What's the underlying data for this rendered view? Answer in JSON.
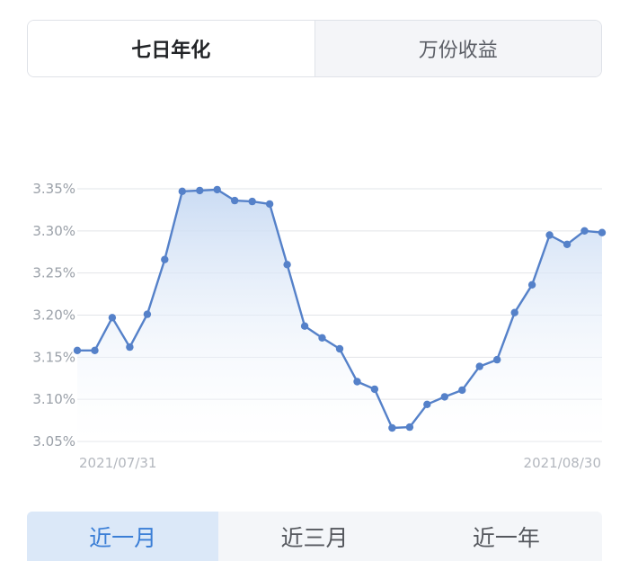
{
  "tabs": [
    {
      "label": "七日年化",
      "active": true
    },
    {
      "label": "万份收益",
      "active": false
    }
  ],
  "range_tabs": [
    {
      "label": "近一月",
      "active": true
    },
    {
      "label": "近三月",
      "active": false
    },
    {
      "label": "近一年",
      "active": false
    }
  ],
  "colors": {
    "line": "#5581c9",
    "fill_top": "#c8daf3",
    "grid": "#e2e4e8",
    "active_tab_text": "#3a7ed6"
  },
  "chart_data": {
    "type": "area",
    "x": [
      "2021/07/31",
      "2021/08/01",
      "2021/08/02",
      "2021/08/03",
      "2021/08/04",
      "2021/08/05",
      "2021/08/06",
      "2021/08/07",
      "2021/08/08",
      "2021/08/09",
      "2021/08/10",
      "2021/08/11",
      "2021/08/12",
      "2021/08/13",
      "2021/08/14",
      "2021/08/15",
      "2021/08/16",
      "2021/08/17",
      "2021/08/18",
      "2021/08/19",
      "2021/08/20",
      "2021/08/21",
      "2021/08/22",
      "2021/08/23",
      "2021/08/24",
      "2021/08/25",
      "2021/08/26",
      "2021/08/27",
      "2021/08/28",
      "2021/08/29",
      "2021/08/30"
    ],
    "values": [
      3.158,
      3.158,
      3.197,
      3.162,
      3.201,
      3.266,
      3.347,
      3.348,
      3.349,
      3.336,
      3.335,
      3.332,
      3.26,
      3.187,
      3.173,
      3.16,
      3.121,
      3.112,
      3.066,
      3.067,
      3.094,
      3.103,
      3.111,
      3.139,
      3.147,
      3.203,
      3.236,
      3.295,
      3.284,
      3.3,
      3.298
    ],
    "yticks": [
      "3.35%",
      "3.30%",
      "3.25%",
      "3.20%",
      "3.15%",
      "3.10%",
      "3.05%"
    ],
    "ytick_values": [
      3.35,
      3.3,
      3.25,
      3.2,
      3.15,
      3.1,
      3.05
    ],
    "ylim": [
      3.05,
      3.35
    ],
    "x_labels": [
      "2021/07/31",
      "2021/08/30"
    ],
    "grid": true
  }
}
